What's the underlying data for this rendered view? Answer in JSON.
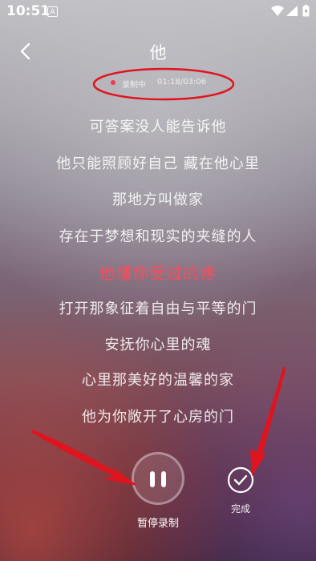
{
  "status_bar": {
    "time": "10:51",
    "app_icon_letter": "A",
    "icons": [
      "wifi-icon",
      "signal-icon",
      "battery-icon"
    ]
  },
  "header": {
    "title": "他",
    "back_icon": "chevron-left-icon"
  },
  "recording": {
    "status_label": "录制中",
    "elapsed": "01:18",
    "total": "03:06",
    "time_display": "01:18/03:06",
    "indicator_color": "#ef3b4a"
  },
  "lyrics": {
    "current_index": 4,
    "lines": [
      "可答案没人能告诉他",
      "他只能照顾好自己 藏在他心里",
      "那地方叫做家",
      "存在于梦想和现实的夹缝的人",
      "他懂你受过的疼",
      "打开那象征着自由与平等的门",
      "安抚你心里的魂",
      "心里那美好的温馨的家",
      "他为你敞开了心房的门"
    ],
    "current_color": "#ff4a5a"
  },
  "controls": {
    "pause_label": "暂停录制",
    "pause_icon": "pause-icon",
    "done_label": "完成",
    "done_icon": "check-circle-icon"
  },
  "annotations": {
    "color": "#e0141e"
  }
}
